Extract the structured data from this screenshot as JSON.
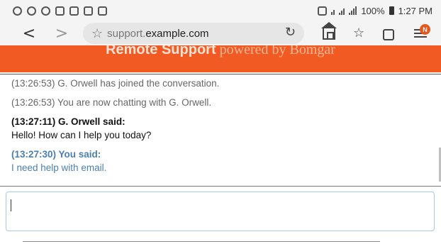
{
  "status_bar": {
    "battery": "100%",
    "time": "1:27 PM"
  },
  "browser": {
    "back_glyph": "<",
    "forward_glyph": ">",
    "url_prefix": "support.",
    "url_domain": "example.com",
    "notification_badge": "N"
  },
  "banner": {
    "brand": "Remote Support",
    "powered": " powered by Bomgar",
    "color": "#f15a22"
  },
  "chat": {
    "system_messages": [
      "(13:26:53) G. Orwell has joined the conversation.",
      "(13:26:53) You are now chatting with G. Orwell."
    ],
    "agent": {
      "header": "(13:27:11) G. Orwell said:",
      "message": "Hello! How can I help you today?"
    },
    "user": {
      "header": "(13:27:30) You said:",
      "message": "I need help with email.",
      "color": "#4a7fb0"
    }
  },
  "input": {
    "value": ""
  }
}
